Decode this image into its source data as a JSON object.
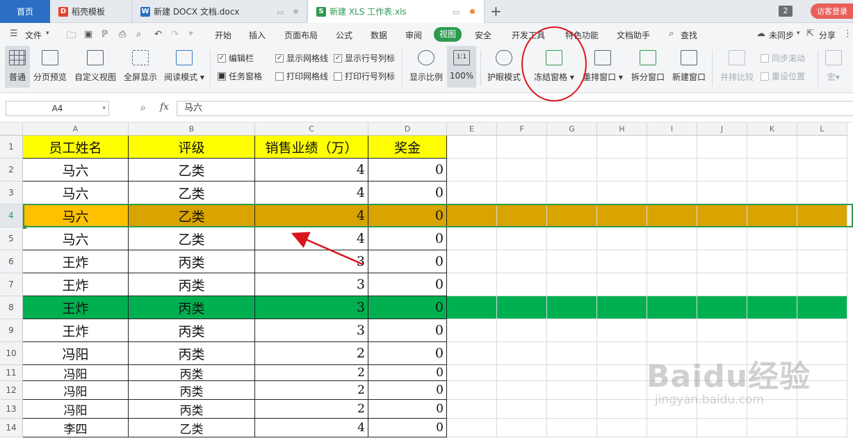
{
  "tabs": {
    "home": "首页",
    "template": "稻壳模板",
    "docx": "新建 DOCX 文档.docx",
    "xls": "新建 XLS 工作表.xls",
    "window_count": "2",
    "login": "访客登录"
  },
  "menu": {
    "file": "文件",
    "items": [
      "开始",
      "插入",
      "页面布局",
      "公式",
      "数据",
      "审阅",
      "视图",
      "安全",
      "开发工具",
      "特色功能",
      "文档助手"
    ],
    "active": "视图",
    "search": "查找",
    "sync": "未同步",
    "share": "分享"
  },
  "ribbon": {
    "normal": "普通",
    "page_break_preview": "分页预览",
    "custom_view": "自定义视图",
    "fullscreen": "全屏显示",
    "reading_mode": "阅读模式",
    "edit_bar": "编辑栏",
    "task_pane": "任务窗格",
    "show_gridlines": "显示网格线",
    "print_gridlines": "打印网格线",
    "show_headings": "显示行号列标",
    "print_headings": "打印行号列标",
    "zoom": "显示比例",
    "zoom_100": "100%",
    "zoom_icon_text": "1:1",
    "eye_protection": "护眼模式",
    "freeze_panes": "冻结窗格",
    "arrange_windows": "重排窗口",
    "split_window": "拆分窗口",
    "new_window": "新建窗口",
    "side_by_side": "并排比较",
    "sync_scroll": "同步滚动",
    "reset_position": "重设位置",
    "macro": "宏"
  },
  "formula_bar": {
    "name_box": "A4",
    "fx": "fx",
    "value": "马六"
  },
  "sheet": {
    "columns": [
      "A",
      "B",
      "C",
      "D",
      "E",
      "F",
      "G",
      "H",
      "I",
      "J",
      "K",
      "L"
    ],
    "header_row": [
      "员工姓名",
      "评级",
      "销售业绩（万）",
      "奖金"
    ],
    "rows": [
      [
        "马六",
        "乙类",
        "4",
        "0"
      ],
      [
        "马六",
        "乙类",
        "4",
        "0"
      ],
      [
        "马六",
        "乙类",
        "4",
        "0"
      ],
      [
        "马六",
        "乙类",
        "4",
        "0"
      ],
      [
        "王炸",
        "丙类",
        "3",
        "0"
      ],
      [
        "王炸",
        "丙类",
        "3",
        "0"
      ],
      [
        "王炸",
        "丙类",
        "3",
        "0"
      ],
      [
        "王炸",
        "丙类",
        "3",
        "0"
      ],
      [
        "冯阳",
        "丙类",
        "2",
        "0"
      ],
      [
        "冯阳",
        "丙类",
        "2",
        "0"
      ],
      [
        "冯阳",
        "丙类",
        "2",
        "0"
      ],
      [
        "冯阳",
        "丙类",
        "2",
        "0"
      ],
      [
        "李四",
        "乙类",
        "4",
        "0"
      ]
    ],
    "row_numbers": [
      "1",
      "2",
      "3",
      "4",
      "5",
      "6",
      "7",
      "8",
      "9",
      "10",
      "11",
      "12",
      "13",
      "14"
    ],
    "selected_row": "4",
    "highlight_row": "8"
  },
  "colors": {
    "header_fill": "#ffff00",
    "selected_row_fill": "#d9a400",
    "selected_cell_fill": "#ffc000",
    "green_row_fill": "#00b050",
    "accent": "#2e9a50",
    "annotation": "#d9161c"
  },
  "watermark": {
    "brand": "Baidu经验",
    "url": "jingyan.baidu.com"
  }
}
